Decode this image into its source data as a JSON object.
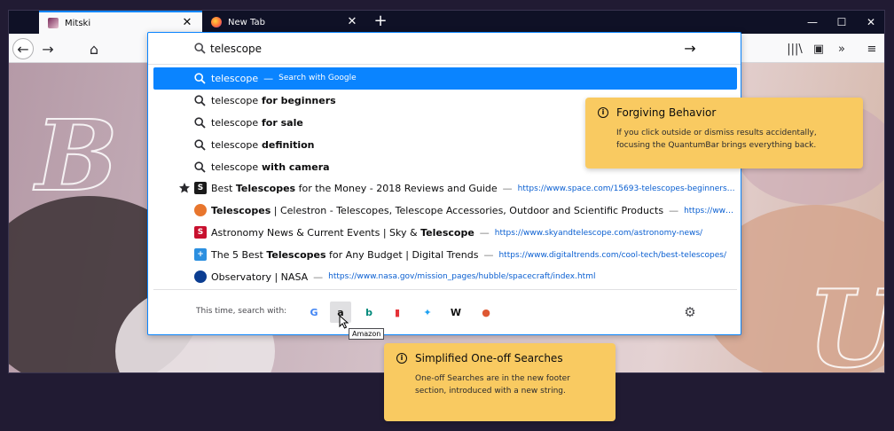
{
  "tabs": [
    {
      "title": "Mitski",
      "close": "✕"
    },
    {
      "title": "New Tab",
      "close": "✕"
    }
  ],
  "new_tab_glyph": "+",
  "window_controls": {
    "minimize": "—",
    "maximize": "☐",
    "close": "✕"
  },
  "nav": {
    "back": "←",
    "forward": "→",
    "home": "⌂"
  },
  "toolbar_right": {
    "library": "|||\\",
    "sidebar": "▣",
    "overflow": "»",
    "menu": "≡"
  },
  "urlbar": {
    "value": "telescope",
    "go": "→"
  },
  "results": [
    {
      "kind": "search",
      "query": "telescope",
      "suffix": "",
      "action": "Search with Google",
      "selected": true
    },
    {
      "kind": "search",
      "query": "telescope",
      "suffix": " for beginners",
      "selected": false
    },
    {
      "kind": "search",
      "query": "telescope",
      "suffix": " for sale",
      "selected": false
    },
    {
      "kind": "search",
      "query": "telescope",
      "suffix": " definition",
      "selected": false
    },
    {
      "kind": "search",
      "query": "telescope",
      "suffix": " with camera",
      "selected": false
    },
    {
      "kind": "page",
      "starred": true,
      "pre": "Best ",
      "bold": "Telescopes",
      "post": " for the Money - 2018 Reviews and Guide",
      "url": "https://www.space.com/15693-telescopes-beginners…",
      "favicon": "S",
      "favicon_color": "#1a1a1a"
    },
    {
      "kind": "page",
      "starred": false,
      "pre": "",
      "bold": "Telescopes",
      "post": " | Celestron - Telescopes, Telescope Accessories, Outdoor and Scientific Products",
      "url": "https://www.…",
      "favicon": "",
      "favicon_color": "#e8762d"
    },
    {
      "kind": "page",
      "starred": false,
      "pre": "Astronomy News & Current Events | Sky & ",
      "bold": "Telescope",
      "post": "",
      "url": "https://www.skyandtelescope.com/astronomy-news/",
      "favicon": "S",
      "favicon_color": "#c8102e"
    },
    {
      "kind": "page",
      "starred": false,
      "pre": "The 5 Best ",
      "bold": "Telescopes",
      "post": " for Any Budget | Digital Trends",
      "url": "https://www.digitaltrends.com/cool-tech/best-telescopes/",
      "favicon": "+",
      "favicon_color": "#2b8fe0"
    },
    {
      "kind": "page",
      "starred": false,
      "pre": "Observatory | NASA",
      "bold": "",
      "post": "",
      "url": "https://www.nasa.gov/mission_pages/hubble/spacecraft/index.html",
      "favicon": "",
      "favicon_color": "#0b3d91"
    }
  ],
  "separator": "—",
  "footer": {
    "label": "This time, search with:",
    "engines": [
      {
        "name": "Google",
        "glyph": "G",
        "color": "#4285f4"
      },
      {
        "name": "Amazon",
        "glyph": "a",
        "color": "#111111"
      },
      {
        "name": "Bing",
        "glyph": "b",
        "color": "#00897b"
      },
      {
        "name": "eBay",
        "glyph": "▮",
        "color": "#e53238"
      },
      {
        "name": "Twitter",
        "glyph": "✦",
        "color": "#1da1f2"
      },
      {
        "name": "Wikipedia",
        "glyph": "W",
        "color": "#111111"
      },
      {
        "name": "DuckDuckGo",
        "glyph": "●",
        "color": "#de5833"
      }
    ],
    "settings": "⚙",
    "tooltip": "Amazon"
  },
  "callouts": {
    "forgiving": {
      "title": "Forgiving Behavior",
      "body1": "If you click outside or dismiss results accidentally,",
      "body2": "focusing the QuantumBar brings everything back."
    },
    "oneoff": {
      "title": "Simplified One-off Searches",
      "body1": "One-off Searches are in the new footer",
      "body2": "section, introduced with a new string."
    }
  },
  "colors": {
    "accent": "#0a84ff",
    "callout": "#f9ca61",
    "chrome_dark": "#0f1126"
  }
}
